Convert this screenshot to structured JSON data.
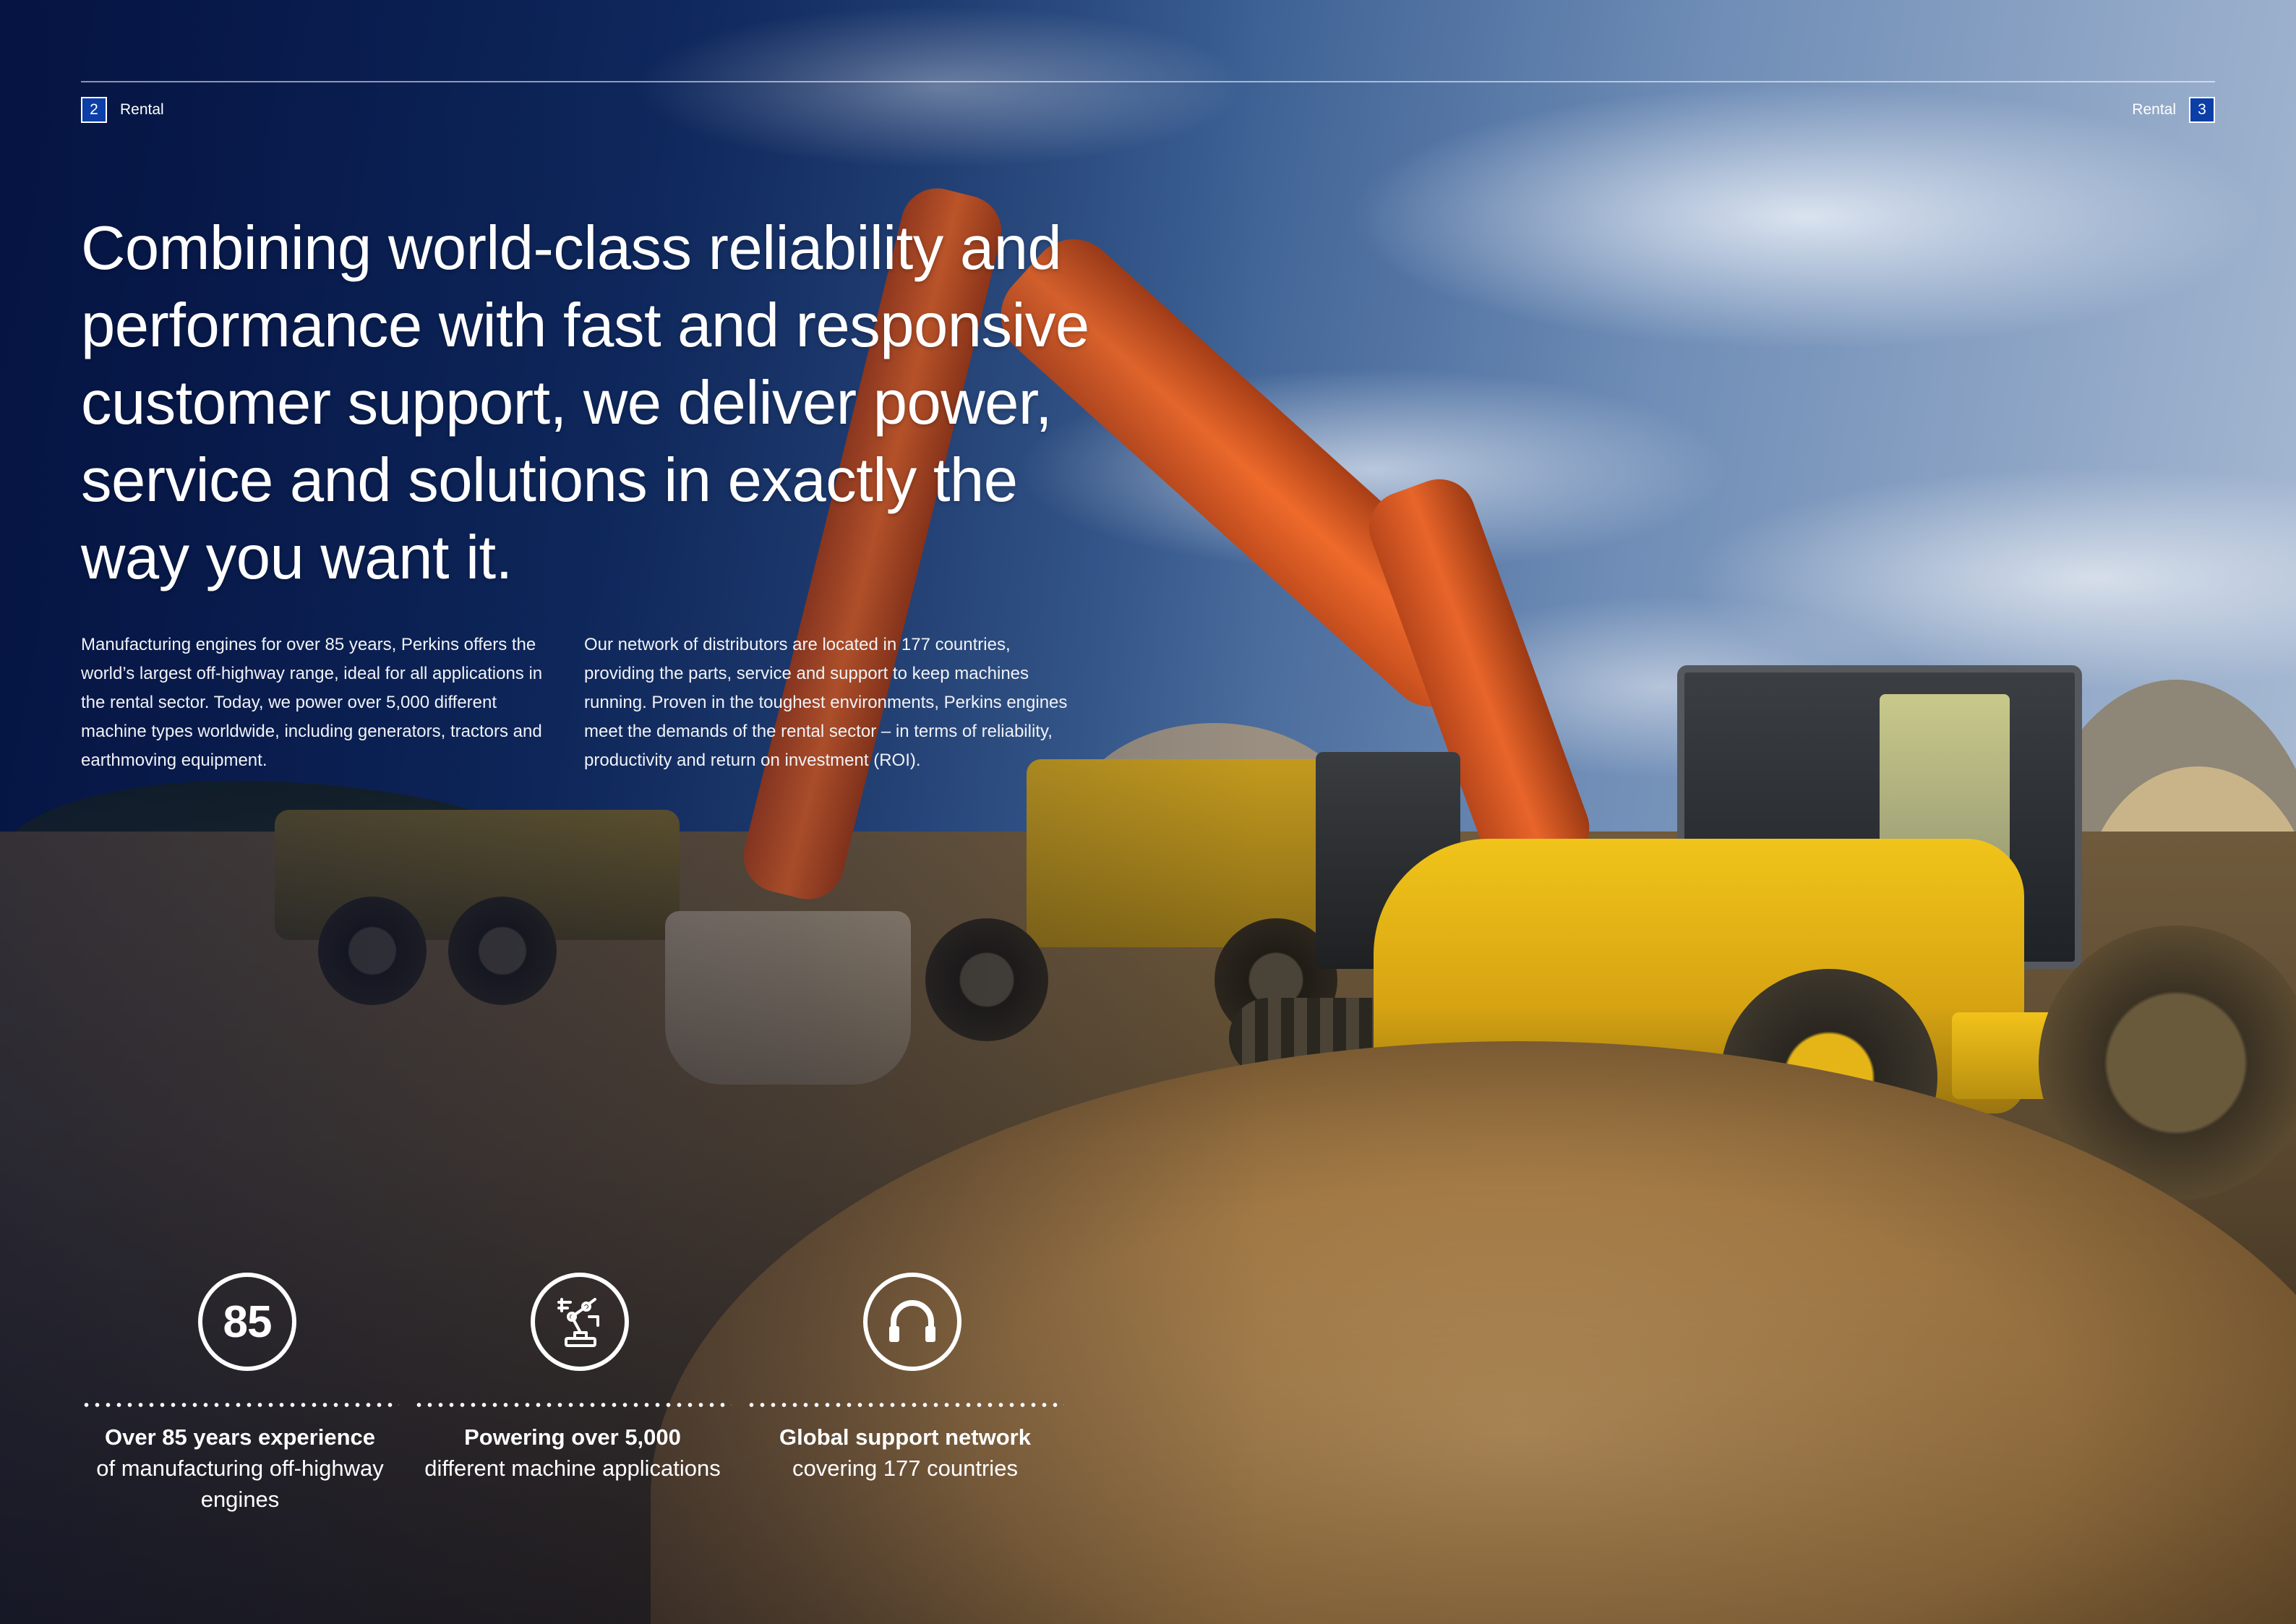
{
  "header": {
    "left_page_number": "2",
    "left_section": "Rental",
    "right_page_number": "3",
    "right_section": "Rental"
  },
  "headline": "Combining world-class reliability and performance with fast and responsive customer support, we deliver power, service and solutions in exactly the way you want it.",
  "body": {
    "column1": "Manufacturing engines for over 85 years, Perkins offers the world’s largest off-highway range, ideal for all applications in the rental sector. Today, we power over 5,000 different machine types worldwide, including generators, tractors and earthmoving equipment.",
    "column2": "Our network of distributors are located in 177 countries, providing the parts, service and support to keep machines running. Proven in the toughest environments, Perkins engines meet the demands of the rental sector – in terms of reliability, productivity and return on investment (ROI)."
  },
  "stats": [
    {
      "icon": "number-85-icon",
      "icon_text": "85",
      "title": "Over 85 years experience",
      "description": "of manufacturing off-highway engines"
    },
    {
      "icon": "robot-arm-icon",
      "title": "Powering over 5,000",
      "description": "different machine applications"
    },
    {
      "icon": "headset-icon",
      "title": "Global support network",
      "description": "covering 177 countries"
    }
  ],
  "colors": {
    "page_number_bg": "#0c3ea8",
    "text": "#ffffff",
    "sky_dark": "#071a55"
  }
}
